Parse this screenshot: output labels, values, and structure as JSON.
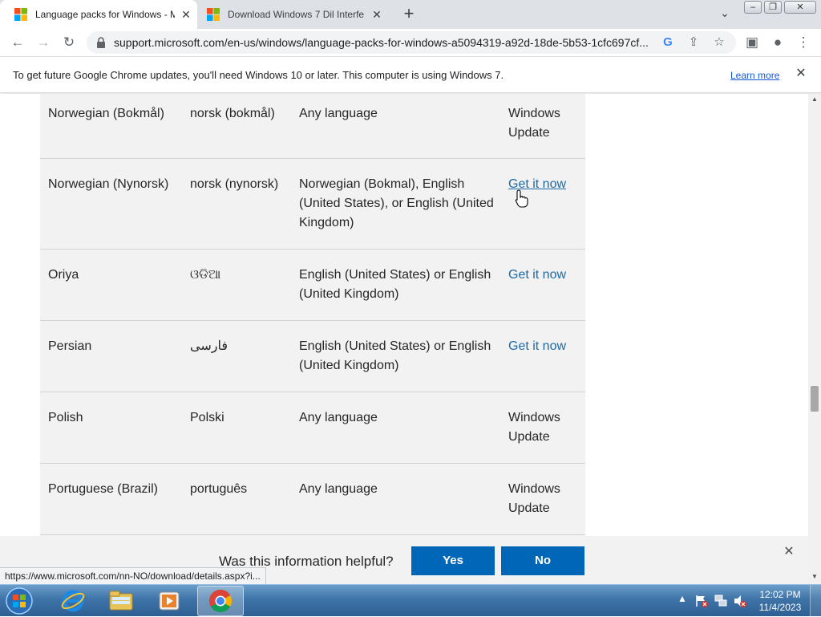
{
  "browser": {
    "tabs": [
      {
        "title": "Language packs for Windows - M",
        "close": "✕"
      },
      {
        "title": "Download Windows 7 Dil Interfe",
        "close": "✕"
      }
    ],
    "new_tab": "+",
    "tab_list": "⌄",
    "window_controls": {
      "minimize": "–",
      "restore": "❐",
      "close": "✕"
    },
    "nav": {
      "back": "←",
      "forward": "→",
      "reload": "↻"
    },
    "url": "support.microsoft.com/en-us/windows/language-packs-for-windows-a5094319-a92d-18de-5b53-1cfc697cf...",
    "omnibox_icons": {
      "google": "G",
      "share": "⇪",
      "bookmark": "☆"
    },
    "toolbar_icons": {
      "side_panel": "▣",
      "profile": "●",
      "menu": "⋮"
    }
  },
  "infobar": {
    "message": "To get future Google Chrome updates, you'll need Windows 10 or later. This computer is using Windows 7.",
    "learn_more": "Learn more",
    "close": "✕"
  },
  "table": {
    "rows": [
      {
        "language": "Norwegian (Bokmål)",
        "native": "norsk (bokmål)",
        "base": "Any language",
        "get": "Windows Update",
        "is_link": false
      },
      {
        "language": "Norwegian (Nynorsk)",
        "native": "norsk (nynorsk)",
        "base": "Norwegian (Bokmal), English (United States), or English (United Kingdom)",
        "get": "Get it now",
        "is_link": true
      },
      {
        "language": "Oriya",
        "native": "ଓଡିଆ",
        "base": "English (United States) or English (United Kingdom)",
        "get": "Get it now",
        "is_link": true
      },
      {
        "language": "Persian",
        "native": "فارسی",
        "base": "English (United States) or English (United Kingdom)",
        "get": "Get it now",
        "is_link": true
      },
      {
        "language": "Polish",
        "native": "Polski",
        "base": "Any language",
        "get": "Windows Update",
        "is_link": false
      },
      {
        "language": "Portuguese (Brazil)",
        "native": "português",
        "base": "Any language",
        "get": "Windows Update",
        "is_link": false
      }
    ]
  },
  "feedback": {
    "question": "Was this information helpful?",
    "yes": "Yes",
    "no": "No",
    "close": "✕"
  },
  "status_url": "https://www.microsoft.com/nn-NO/download/details.aspx?i...",
  "scrollbar": {
    "up": "▲",
    "down": "▼"
  },
  "taskbar": {
    "time": "12:02 PM",
    "date": "11/4/2023",
    "tray_arrow": "▲"
  },
  "colors": {
    "link": "#1c6aa8",
    "accent_button": "#0067b8",
    "table_bg": "#f2f2f2",
    "tab_strip": "#dee1e6"
  }
}
